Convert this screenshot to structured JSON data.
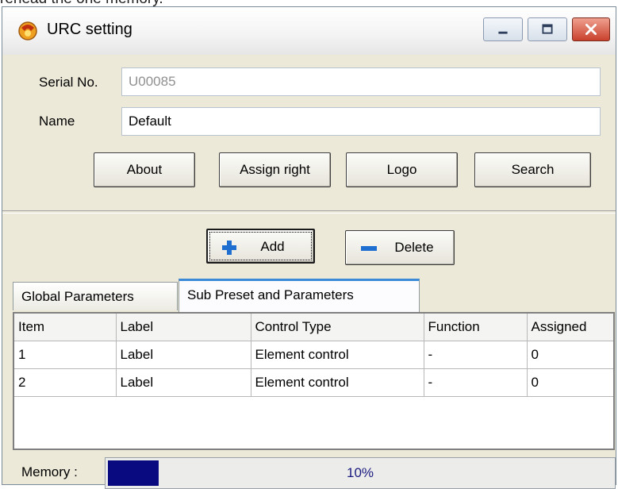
{
  "above_text": "rehead the one memory.",
  "window": {
    "title": "URC setting",
    "app_icon": "urc-app-icon",
    "controls": [
      "minimize-icon",
      "maximize-icon",
      "close-icon"
    ]
  },
  "form": {
    "serial_label": "Serial No.",
    "serial_value": "U00085",
    "name_label": "Name",
    "name_value": "Default"
  },
  "buttons": {
    "about": "About",
    "assign_right": "Assign right",
    "logo": "Logo",
    "search": "Search",
    "add": "Add",
    "delete": "Delete"
  },
  "tabs": [
    {
      "label": "Global Parameters",
      "active": false
    },
    {
      "label": "Sub Preset and Parameters",
      "active": true
    }
  ],
  "table": {
    "columns": [
      "Item",
      "Label",
      "Control Type",
      "Function",
      "Assigned"
    ],
    "rows": [
      [
        "1",
        "Label",
        "Element control",
        "-",
        "0"
      ],
      [
        "2",
        "Label",
        "Element control",
        "-",
        "0"
      ]
    ]
  },
  "memory": {
    "label": "Memory :",
    "percent": 10,
    "percent_text": "10%"
  },
  "colors": {
    "progress_fill": "#0a0a80",
    "active_tab_accent": "#3a8ad8",
    "close_button": "#c8412c"
  }
}
